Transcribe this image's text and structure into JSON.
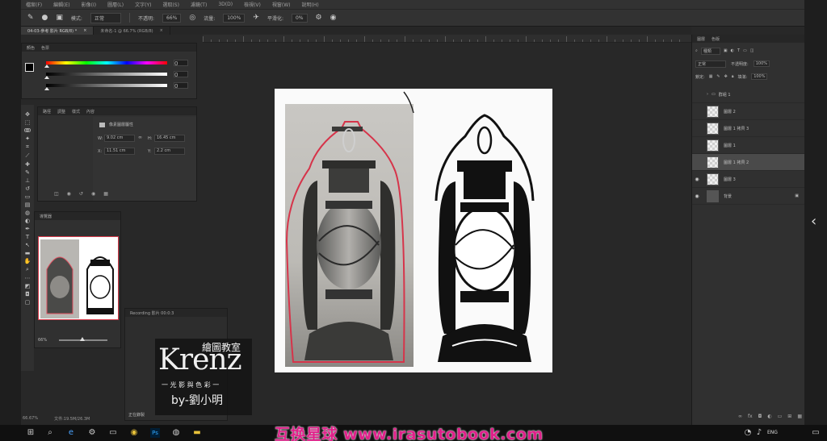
{
  "menubar": {
    "items": [
      "檔案(F)",
      "編輯(E)",
      "影像(I)",
      "圖層(L)",
      "文字(Y)",
      "選取(S)",
      "濾鏡(T)",
      "3D(D)",
      "檢視(V)",
      "視窗(W)",
      "說明(H)"
    ]
  },
  "options_bar": {
    "mode_label": "模式:",
    "mode_value": "正常",
    "opacity_label": "不透明:",
    "opacity_value": "66%",
    "flow_label": "流量:",
    "flow_value": "100%",
    "smooth_label": "平滑化:",
    "smooth_value": "0%"
  },
  "doc_tabs": [
    {
      "label": "04-03-參考 影片 RGB/8) *",
      "active": true
    },
    {
      "label": "未命名-1 @ 66.7% (RGB/8)",
      "active": false
    }
  ],
  "color_panel": {
    "tabs": [
      "顏色",
      "色票"
    ],
    "values": [
      "0",
      "0",
      "0"
    ],
    "units": [
      "%",
      "%",
      "%"
    ]
  },
  "props_panel": {
    "tabs": [
      "路徑",
      "調整",
      "樣式",
      "內容"
    ],
    "title": "像素圖層屬性",
    "w_label": "W:",
    "w_value": "9.02 cm",
    "h_label": "H:",
    "h_value": "16.45 cm",
    "x_label": "X:",
    "x_value": "11.51 cm",
    "y_label": "Y:",
    "y_value": "2.2 cm"
  },
  "navigator": {
    "tab": "導覽器",
    "zoom": "66%"
  },
  "small_window": {
    "title": "Recording 影片 00:0:3",
    "status": "正在錄製"
  },
  "layers_panel": {
    "tabs": [
      "圖層",
      "色版"
    ],
    "kind_label": "種類",
    "blend_mode": "正常",
    "opacity_label": "不透明度:",
    "opacity_value": "100%",
    "lock_label": "鎖定:",
    "fill_label": "填滿:",
    "fill_value": "100%",
    "rows": [
      {
        "name": "群組 1",
        "eye": false,
        "selected": false,
        "group": true
      },
      {
        "name": "圖層 2",
        "eye": false,
        "selected": false,
        "group": false
      },
      {
        "name": "圖層 1 拷貝 3",
        "eye": false,
        "selected": false,
        "group": false
      },
      {
        "name": "圖層 1",
        "eye": false,
        "selected": false,
        "group": false
      },
      {
        "name": "圖層 1 拷貝 2",
        "eye": false,
        "selected": true,
        "group": false
      },
      {
        "name": "圖層 3",
        "eye": true,
        "selected": false,
        "group": false
      },
      {
        "name": "背景",
        "eye": true,
        "selected": false,
        "group": false
      }
    ]
  },
  "status_bar": {
    "zoom": "66.67%",
    "doc_size": "文件:19.5M/26.3M"
  },
  "branding": {
    "school": "繪圖教室",
    "logo": "Krenz",
    "subtitle": "一 光 影 與 色 彩 一",
    "author": "by-劉小明"
  },
  "taskbar": {
    "lang": "ENG",
    "time": "",
    "icons": [
      "windows-icon",
      "search-icon",
      "edge-icon",
      "settings-icon",
      "explorer-icon",
      "chrome-icon",
      "photoshop-icon",
      "steam-icon",
      "folder-icon"
    ]
  },
  "watermark": "互换星球 www.irasutobook.com",
  "colors": {
    "accent_pink": "#e0208a",
    "panel_bg": "#303030",
    "canvas_bg": "#282828",
    "selection_red": "#d63a4a"
  }
}
